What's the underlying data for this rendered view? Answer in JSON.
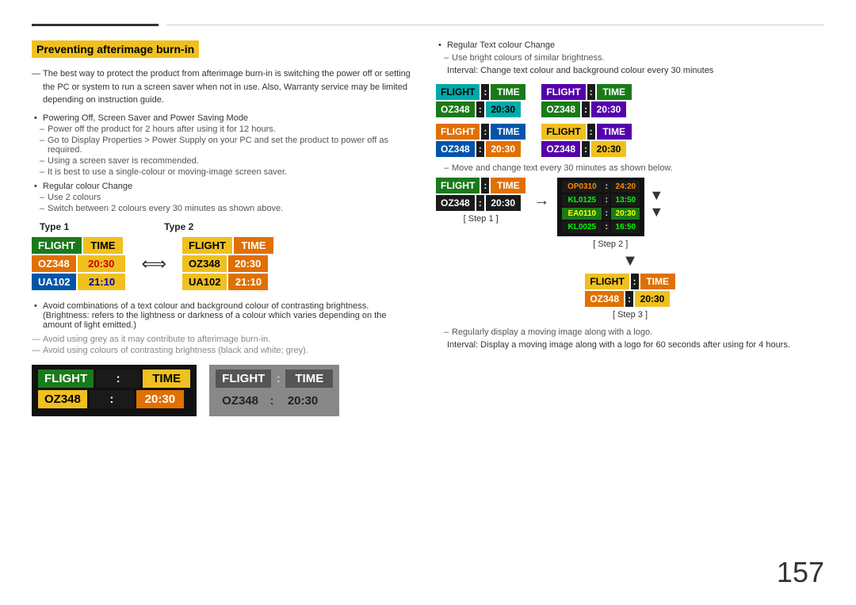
{
  "page": {
    "number": "157",
    "title": "Preventing afterimage burn-in"
  },
  "left": {
    "intro_dash": "The best way to protect the product from afterimage burn-in is switching the power off or setting the PC or system to run a screen saver when not in use. Also, Warranty service may be limited depending on instruction guide.",
    "bullets": [
      {
        "text": "Powering Off, Screen Saver and Power Saving Mode",
        "subs": [
          "Power off the product for 2 hours after using it for 12 hours.",
          "Go to Display Properties > Power Supply on your PC and set the product to power off as required.",
          "Using a screen saver is recommended.",
          "It is best to use a single-colour or moving-image screen saver."
        ]
      },
      {
        "text": "Regular colour Change",
        "subs": [
          "Use 2 colours",
          "Switch between 2 colours every 30 minutes as shown above."
        ]
      }
    ],
    "type1_label": "Type 1",
    "type2_label": "Type 2",
    "avoid_text1": "Avoid combinations of a text colour and background colour of contrasting brightness. (Brightness: refers to the lightness or darkness of a colour which varies depending on the amount of light emitted.)",
    "avoid_dash1": "Avoid using grey as it may contribute to afterimage burn-in.",
    "avoid_dash2": "Avoid using colours of contrasting brightness (black and white; grey)."
  },
  "right": {
    "bullet": {
      "text": "Regular Text colour Change",
      "sub1": "Use bright colours of similar brightness.",
      "sub2": "Interval: Change text colour and background colour every 30 minutes"
    },
    "move_text": "Move and change text every 30 minutes as shown below.",
    "step1_label": "[ Step 1 ]",
    "step2_label": "[ Step 2 ]",
    "step3_label": "[ Step 3 ]",
    "regularly_text": "Regularly display a moving image along with a logo.",
    "regularly_sub": "Interval: Display a moving image along with a logo for 60 seconds after using for 4 hours."
  },
  "boards": {
    "flight": "FLIGHT",
    "time": "TIME",
    "colon": ":",
    "oz348": "OZ348",
    "val2030": "20:30",
    "ua102": "UA102",
    "val2110": "21:10",
    "scroll": {
      "row1": [
        "OP0310",
        ":",
        "24:20"
      ],
      "row2": [
        "KL0125",
        ":",
        "13:50"
      ],
      "row3": [
        "EA0110",
        ":",
        "20:30"
      ],
      "row4": [
        "KL0025",
        ":",
        "16:50"
      ]
    }
  }
}
